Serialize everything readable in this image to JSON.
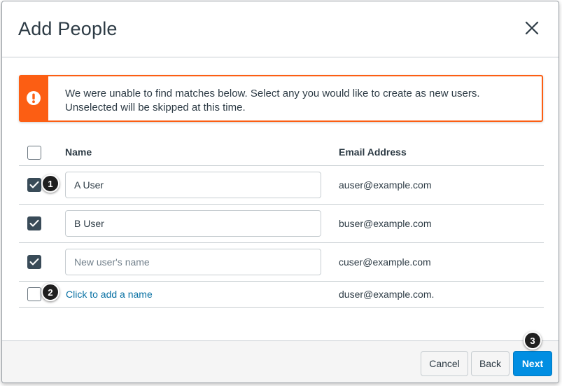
{
  "dialog": {
    "title": "Add People",
    "close_icon": "close-icon"
  },
  "alert": {
    "icon": "warning-icon",
    "message": "We were unable to find matches below. Select any you would like to create as new users. Unselected will be skipped at this time.",
    "color": "#fc5e13"
  },
  "table": {
    "headers": {
      "name": "Name",
      "email": "Email Address"
    },
    "select_all_checked": false,
    "rows": [
      {
        "checked": true,
        "name_value": "A User",
        "name_placeholder": "New user's name",
        "email": "auser@example.com"
      },
      {
        "checked": true,
        "name_value": "B User",
        "name_placeholder": "New user's name",
        "email": "buser@example.com"
      },
      {
        "checked": true,
        "name_value": "",
        "name_placeholder": "New user's name",
        "email": "cuser@example.com"
      },
      {
        "checked": false,
        "add_name_link": "Click to add a name",
        "email": "duser@example.com."
      }
    ]
  },
  "callouts": [
    "1",
    "2",
    "3"
  ],
  "footer": {
    "cancel_label": "Cancel",
    "back_label": "Back",
    "next_label": "Next"
  },
  "colors": {
    "primary": "#008ee2",
    "checkbox": "#394b58",
    "link": "#0770a3"
  }
}
